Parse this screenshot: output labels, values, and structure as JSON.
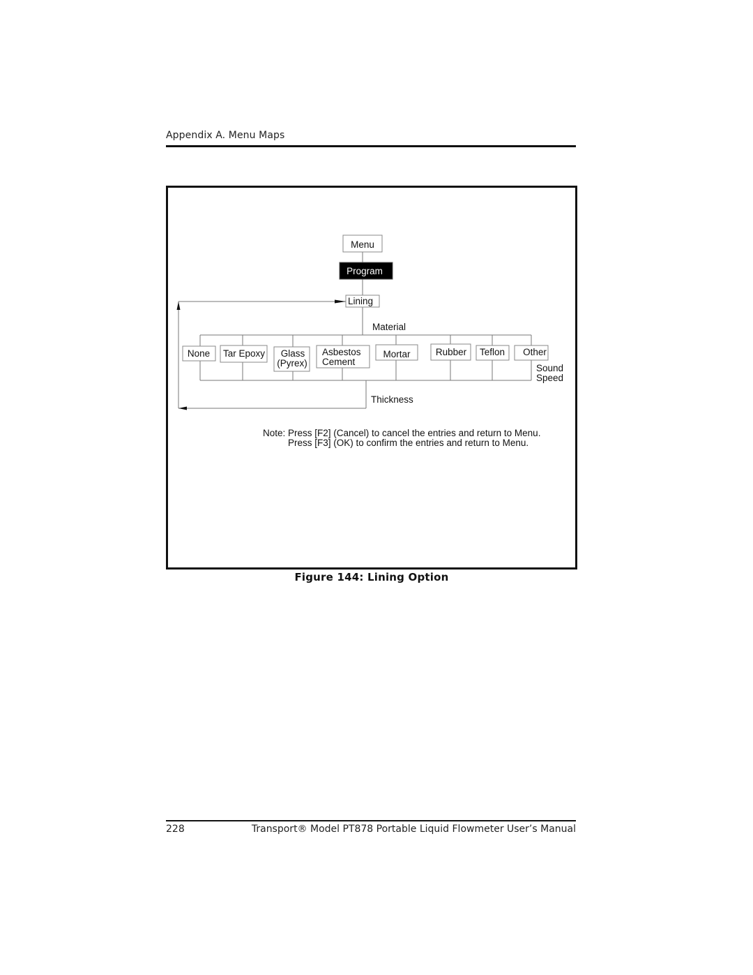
{
  "header": {
    "section_title": "Appendix A. Menu Maps"
  },
  "diagram": {
    "root": "Menu",
    "selected": "Program",
    "option": "Lining",
    "parameter_label": "Material",
    "materials": [
      {
        "line1": "None",
        "line2": ""
      },
      {
        "line1": "Tar Epoxy",
        "line2": ""
      },
      {
        "line1": "Glass",
        "line2": "(Pyrex)"
      },
      {
        "line1": "Asbestos",
        "line2": "Cement"
      },
      {
        "line1": "Mortar",
        "line2": ""
      },
      {
        "line1": "Rubber",
        "line2": ""
      },
      {
        "line1": "Teflon",
        "line2": ""
      },
      {
        "line1": "Other",
        "line2": ""
      }
    ],
    "other_sub": [
      "Sound",
      "Speed"
    ],
    "next_parameter": "Thickness",
    "note_line1": "Note: Press [F2] (Cancel) to cancel the entries and return to Menu.",
    "note_line2": "Press [F3] (OK) to confirm the entries and return to Menu."
  },
  "figure": {
    "caption": "Figure 144: Lining Option"
  },
  "footer": {
    "page_number": "228",
    "manual_title": "Transport® Model PT878 Portable Liquid Flowmeter User’s Manual"
  }
}
